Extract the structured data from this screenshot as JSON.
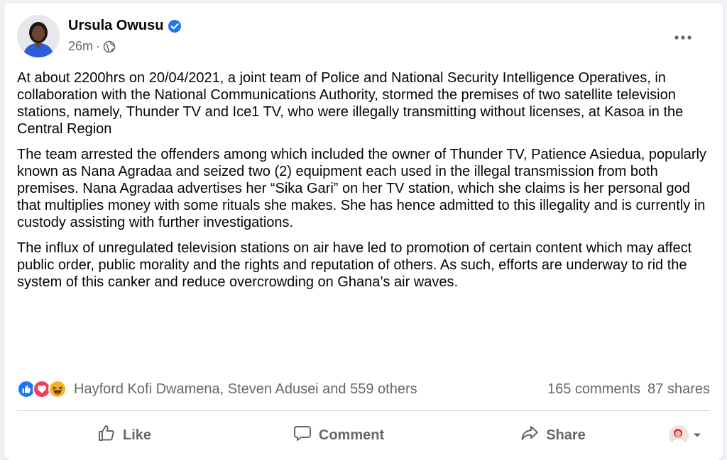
{
  "post": {
    "author": "Ursula Owusu",
    "time": "26m",
    "separator": "·",
    "icons": {
      "verified": "verified-badge-icon",
      "audience": "globe-icon",
      "more": "more-horizontal-icon"
    },
    "paragraphs": [
      "At about 2200hrs on 20/04/2021, a joint team of Police and National Security Intelligence Operatives, in collaboration with the National Communications Authority, stormed the premises of two satellite television stations, namely, Thunder TV and Ice1 TV, who were illegally transmitting without licenses, at Kasoa in the Central Region",
      "The team arrested the offenders among which included the owner of Thunder TV, Patience Asiedua, popularly known as Nana Agradaa and seized two (2) equipment each used in the illegal transmission from both premises. Nana Agradaa advertises her “Sika Gari” on her TV station, which she claims is her personal god that multiplies money with some rituals she makes. She has hence admitted to this illegality and is currently in custody assisting with further investigations.",
      "The influx of unregulated television stations on air have led to promotion of certain content which may affect public order, public morality and the rights and reputation of others. As such, efforts are underway to rid the system of this canker and reduce overcrowding on Ghana’s air waves."
    ]
  },
  "engagement": {
    "reactions": [
      "like",
      "love",
      "haha"
    ],
    "reactors_text": "Hayford Kofi Dwamena, Steven Adusei and 559 others",
    "comments": "165 comments",
    "shares": "87 shares"
  },
  "actions": {
    "like": "Like",
    "comment": "Comment",
    "share": "Share"
  },
  "colors": {
    "like_blue": "#1877f2",
    "love_red": "#f33e58",
    "haha_yellow": "#f7b125",
    "secondary_text": "#65676b"
  }
}
